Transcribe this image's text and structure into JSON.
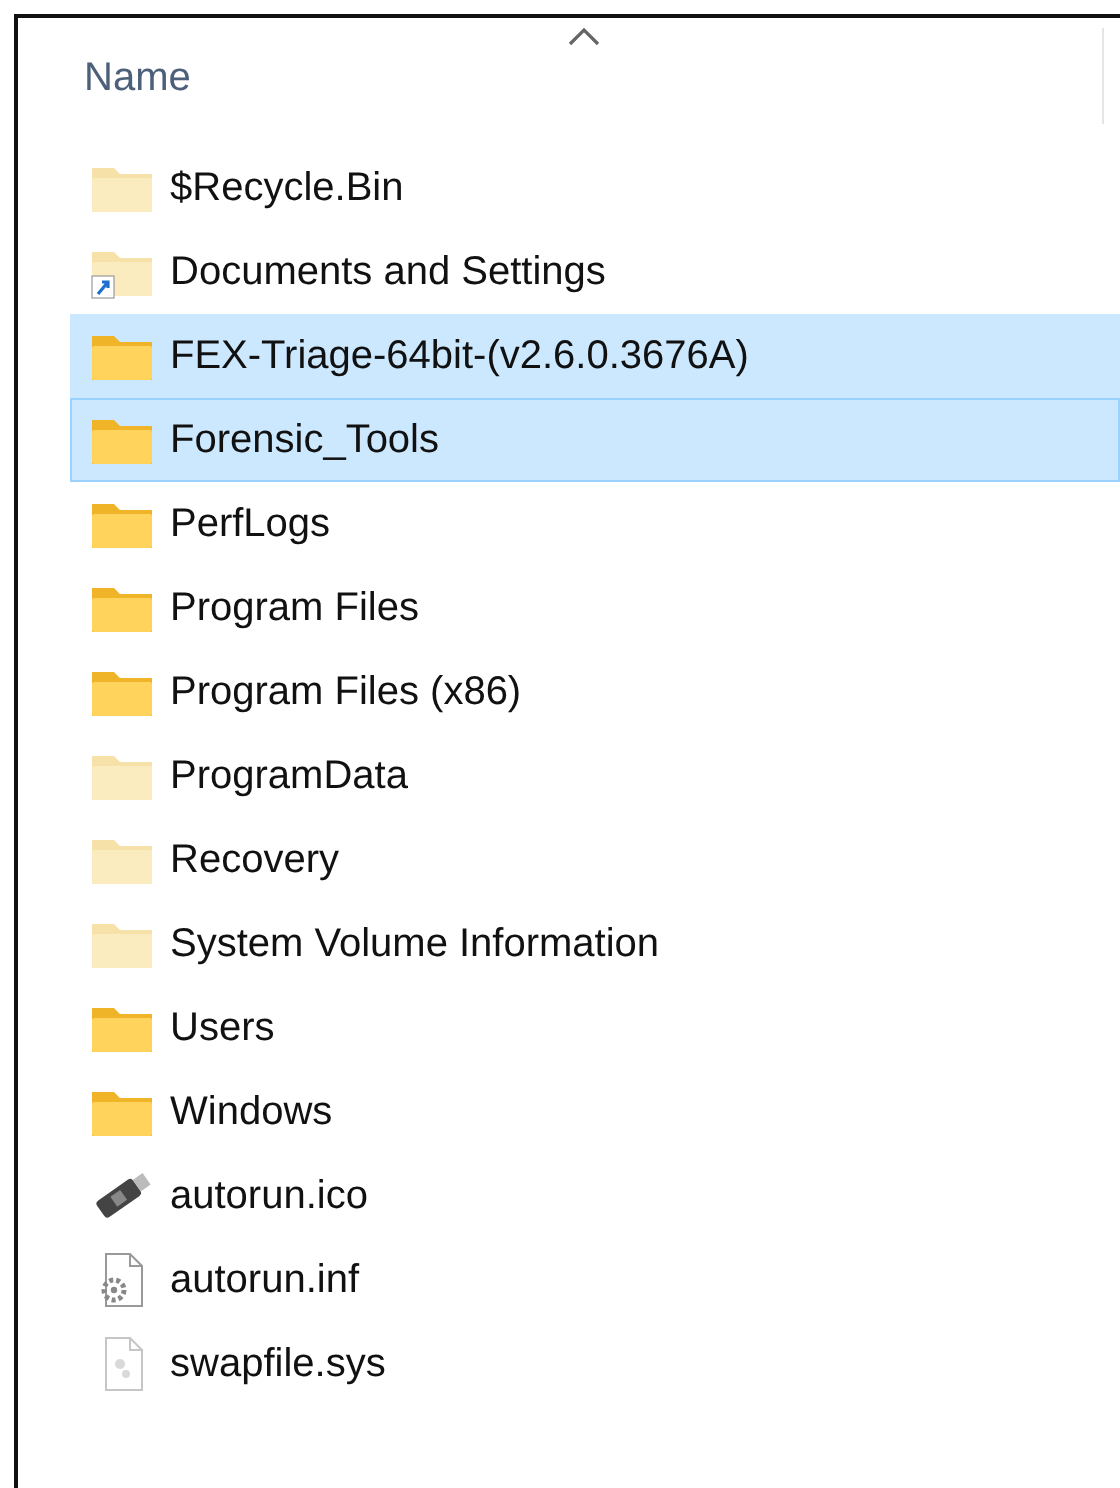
{
  "header": {
    "columns": [
      {
        "label": "Name",
        "sorted_ascending": true
      }
    ]
  },
  "items": [
    {
      "name": "$Recycle.Bin",
      "kind": "folder",
      "hidden": true,
      "shortcut": false,
      "selected": false,
      "focused": false
    },
    {
      "name": "Documents and Settings",
      "kind": "folder",
      "hidden": true,
      "shortcut": true,
      "selected": false,
      "focused": false
    },
    {
      "name": "FEX-Triage-64bit-(v2.6.0.3676A)",
      "kind": "folder",
      "hidden": false,
      "shortcut": false,
      "selected": true,
      "focused": false
    },
    {
      "name": "Forensic_Tools",
      "kind": "folder",
      "hidden": false,
      "shortcut": false,
      "selected": true,
      "focused": true
    },
    {
      "name": "PerfLogs",
      "kind": "folder",
      "hidden": false,
      "shortcut": false,
      "selected": false,
      "focused": false
    },
    {
      "name": "Program Files",
      "kind": "folder",
      "hidden": false,
      "shortcut": false,
      "selected": false,
      "focused": false
    },
    {
      "name": "Program Files (x86)",
      "kind": "folder",
      "hidden": false,
      "shortcut": false,
      "selected": false,
      "focused": false
    },
    {
      "name": "ProgramData",
      "kind": "folder",
      "hidden": true,
      "shortcut": false,
      "selected": false,
      "focused": false
    },
    {
      "name": "Recovery",
      "kind": "folder",
      "hidden": true,
      "shortcut": false,
      "selected": false,
      "focused": false
    },
    {
      "name": "System Volume Information",
      "kind": "folder",
      "hidden": true,
      "shortcut": false,
      "selected": false,
      "focused": false
    },
    {
      "name": "Users",
      "kind": "folder",
      "hidden": false,
      "shortcut": false,
      "selected": false,
      "focused": false
    },
    {
      "name": "Windows",
      "kind": "folder",
      "hidden": false,
      "shortcut": false,
      "selected": false,
      "focused": false
    },
    {
      "name": "autorun.ico",
      "kind": "usb-drive",
      "hidden": false,
      "shortcut": false,
      "selected": false,
      "focused": false
    },
    {
      "name": "autorun.inf",
      "kind": "settings-file",
      "hidden": false,
      "shortcut": false,
      "selected": false,
      "focused": false
    },
    {
      "name": "swapfile.sys",
      "kind": "system-file",
      "hidden": true,
      "shortcut": false,
      "selected": false,
      "focused": false
    }
  ]
}
